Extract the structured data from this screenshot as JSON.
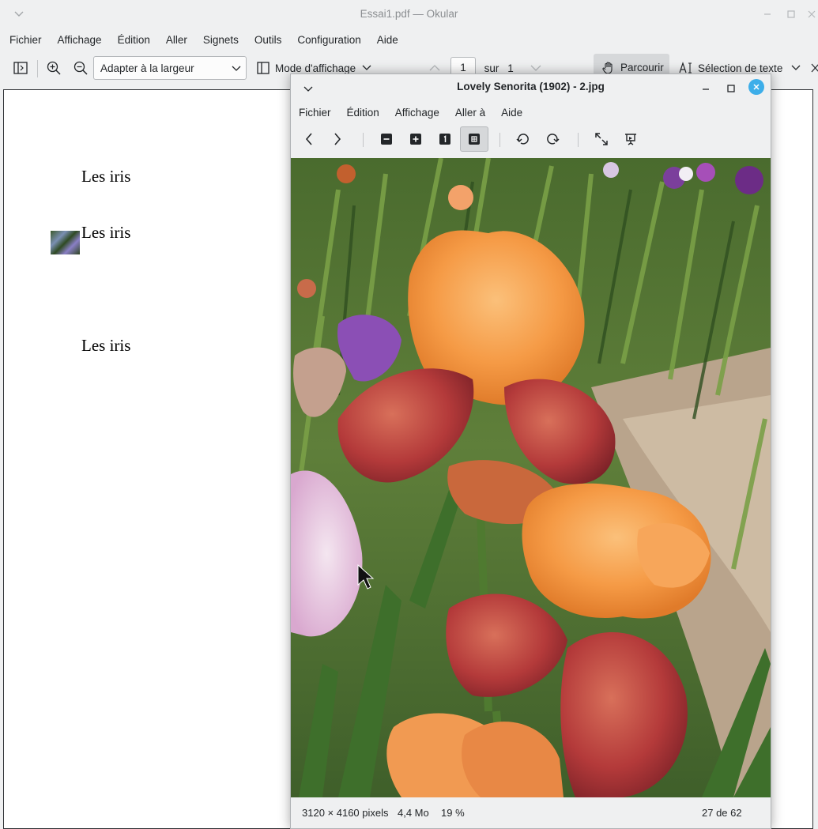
{
  "okular": {
    "title": "Essai1.pdf — Okular",
    "menu": [
      "Fichier",
      "Affichage",
      "Édition",
      "Aller",
      "Signets",
      "Outils",
      "Configuration",
      "Aide"
    ],
    "toolbar": {
      "zoom_value": "Adapter à la largeur",
      "view_mode_label": "Mode d'affichage",
      "page_current": "1",
      "page_of_label": "sur",
      "page_total": "1",
      "browse_label": "Parcourir",
      "text_select_label": "Sélection de texte"
    },
    "pdf": {
      "lines": [
        "Les iris",
        "Les iris",
        "Les iris"
      ]
    }
  },
  "viewer": {
    "title": "Lovely Senorita (1902) - 2.jpg",
    "menu": [
      "Fichier",
      "Édition",
      "Affichage",
      "Aller à",
      "Aide"
    ],
    "status": {
      "dimensions": "3120 × 4160 pixels",
      "size": "4,4 Mo",
      "zoom": "19 %",
      "position": "27 de 62"
    }
  },
  "icons": {
    "window_menu": "chevron-down-icon",
    "minimize": "minimize-icon",
    "maximize": "maximize-icon",
    "close": "close-icon",
    "sidebar": "sidebar-toggle-icon",
    "zoom_in": "zoom-in-icon",
    "zoom_out": "zoom-out-icon",
    "hand": "hand-icon",
    "text_select": "text-cursor-icon"
  },
  "colors": {
    "window_bg": "#eff0f1",
    "accent": "#3daee9",
    "close_active": "#3daee9",
    "active_button": "#d6d8da"
  }
}
